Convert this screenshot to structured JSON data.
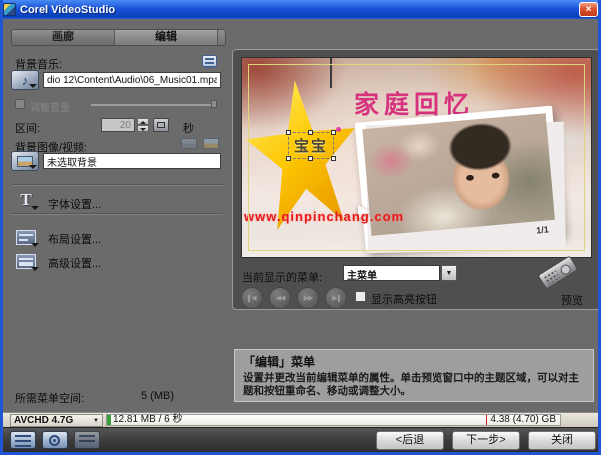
{
  "window": {
    "title": "Corel VideoStudio",
    "close_glyph": "×"
  },
  "tabs": {
    "items": [
      {
        "label": "画廊"
      },
      {
        "label": "编辑"
      }
    ]
  },
  "sidebar": {
    "bg_music_label": "背景音乐:",
    "music_path": "dio 12\\Content\\Audio\\06_Music01.mpa",
    "volume_label": "调整音量",
    "duration_label": "区间:",
    "duration_value": "20",
    "duration_unit": "秒",
    "bg_image_label": "背景图像/视频:",
    "bg_image_value": "未选取背景",
    "font_settings_label": "字体设置...",
    "layout_settings_label": "布局设置...",
    "advanced_settings_label": "高级设置...",
    "menu_space_label": "所需菜单空间:",
    "menu_space_value": "5 (MB)"
  },
  "preview": {
    "menu_title": "家庭回忆",
    "star_text": "宝宝",
    "watermark": "www.qinpinchang.com",
    "page_indicator": "1/1",
    "current_menu_label": "当前显示的菜单:",
    "current_menu_value": "主菜单",
    "highlight_label": "显示高亮按钮",
    "remote_label": "预览"
  },
  "description": {
    "title": "「编辑」菜单",
    "body": "设置并更改当前编辑菜单的属性。单击预览窗口中的主题区域，可以对主题和按钮重命名、移动或调整大小。"
  },
  "statusbar": {
    "format": "AVCHD 4.7G",
    "usage": "12.81 MB / 6 秒",
    "capacity": "4.38 (4.70) GB"
  },
  "footer": {
    "back": "<后退",
    "next": "下一步>",
    "close": "关闭"
  },
  "icons": {
    "note": "♪",
    "dropdown": "▼",
    "first": "◀",
    "prev": "◀◀",
    "next": "▶▶",
    "last": "▶"
  },
  "colors": {
    "titlebar_blue": "#1a54d8",
    "star_yellow": "#fdc803",
    "menu_title_pink": "#d6327e",
    "watermark_red": "#e81818"
  }
}
